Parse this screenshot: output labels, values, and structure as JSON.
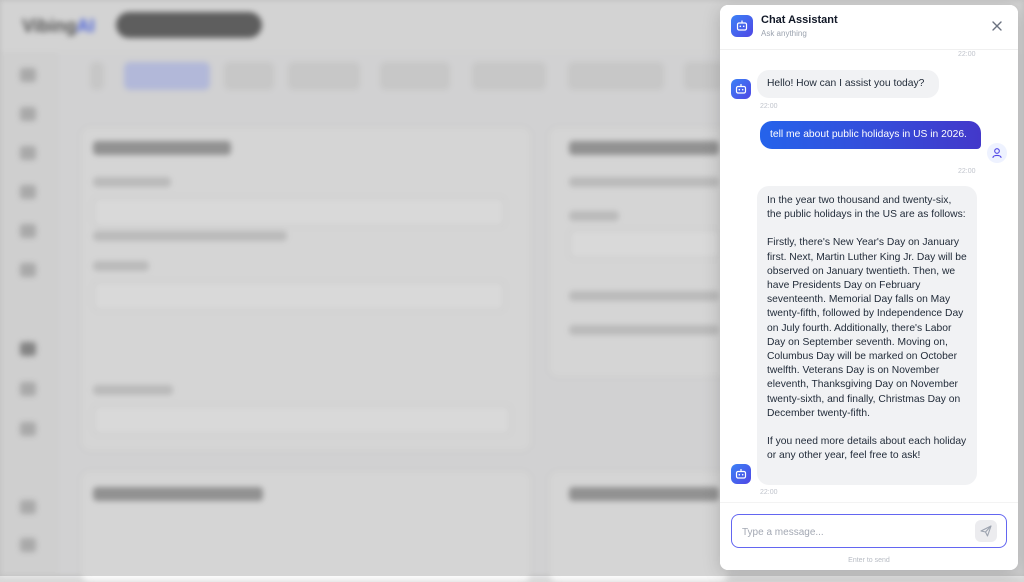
{
  "background": {
    "logo_main": "Vibing",
    "logo_accent": "AI"
  },
  "chat": {
    "title": "Chat Assistant",
    "subtitle": "Ask anything",
    "messages": [
      {
        "role": "assistant",
        "text": "Hello! How can I assist you today?",
        "time": "22:00"
      },
      {
        "role": "user",
        "text": "tell me about public holidays in US in 2026.",
        "time": "22:00"
      },
      {
        "role": "assistant",
        "paragraphs": [
          "In the year two thousand and twenty-six, the public holidays in the US are as follows:",
          "Firstly, there's New Year's Day on January first. Next, Martin Luther King Jr. Day will be observed on January twentieth. Then, we have Presidents Day on February seventeenth. Memorial Day falls on May twenty-fifth, followed by Independence Day on July fourth. Additionally, there's Labor Day on September seventh. Moving on, Columbus Day will be marked on October twelfth. Veterans Day is on November eleventh, Thanksgiving Day on November twenty-sixth, and finally, Christmas Day on December twenty-fifth.",
          "If you need more details about each holiday or any other year, feel free to ask!"
        ],
        "time": "22:00"
      }
    ],
    "top_cut_time": "22:00",
    "input_placeholder": "Type a message...",
    "input_value": "",
    "hint": "Enter to send"
  },
  "icons": {
    "header": "bot-icon",
    "close": "close-icon",
    "assistant_avatar": "bot-icon",
    "user_avatar": "user-icon",
    "send": "send-icon"
  },
  "colors": {
    "accent_start": "#2563eb",
    "accent_end": "#4338ca",
    "input_border": "#6366f1",
    "bot_bubble": "#f1f2f4"
  }
}
